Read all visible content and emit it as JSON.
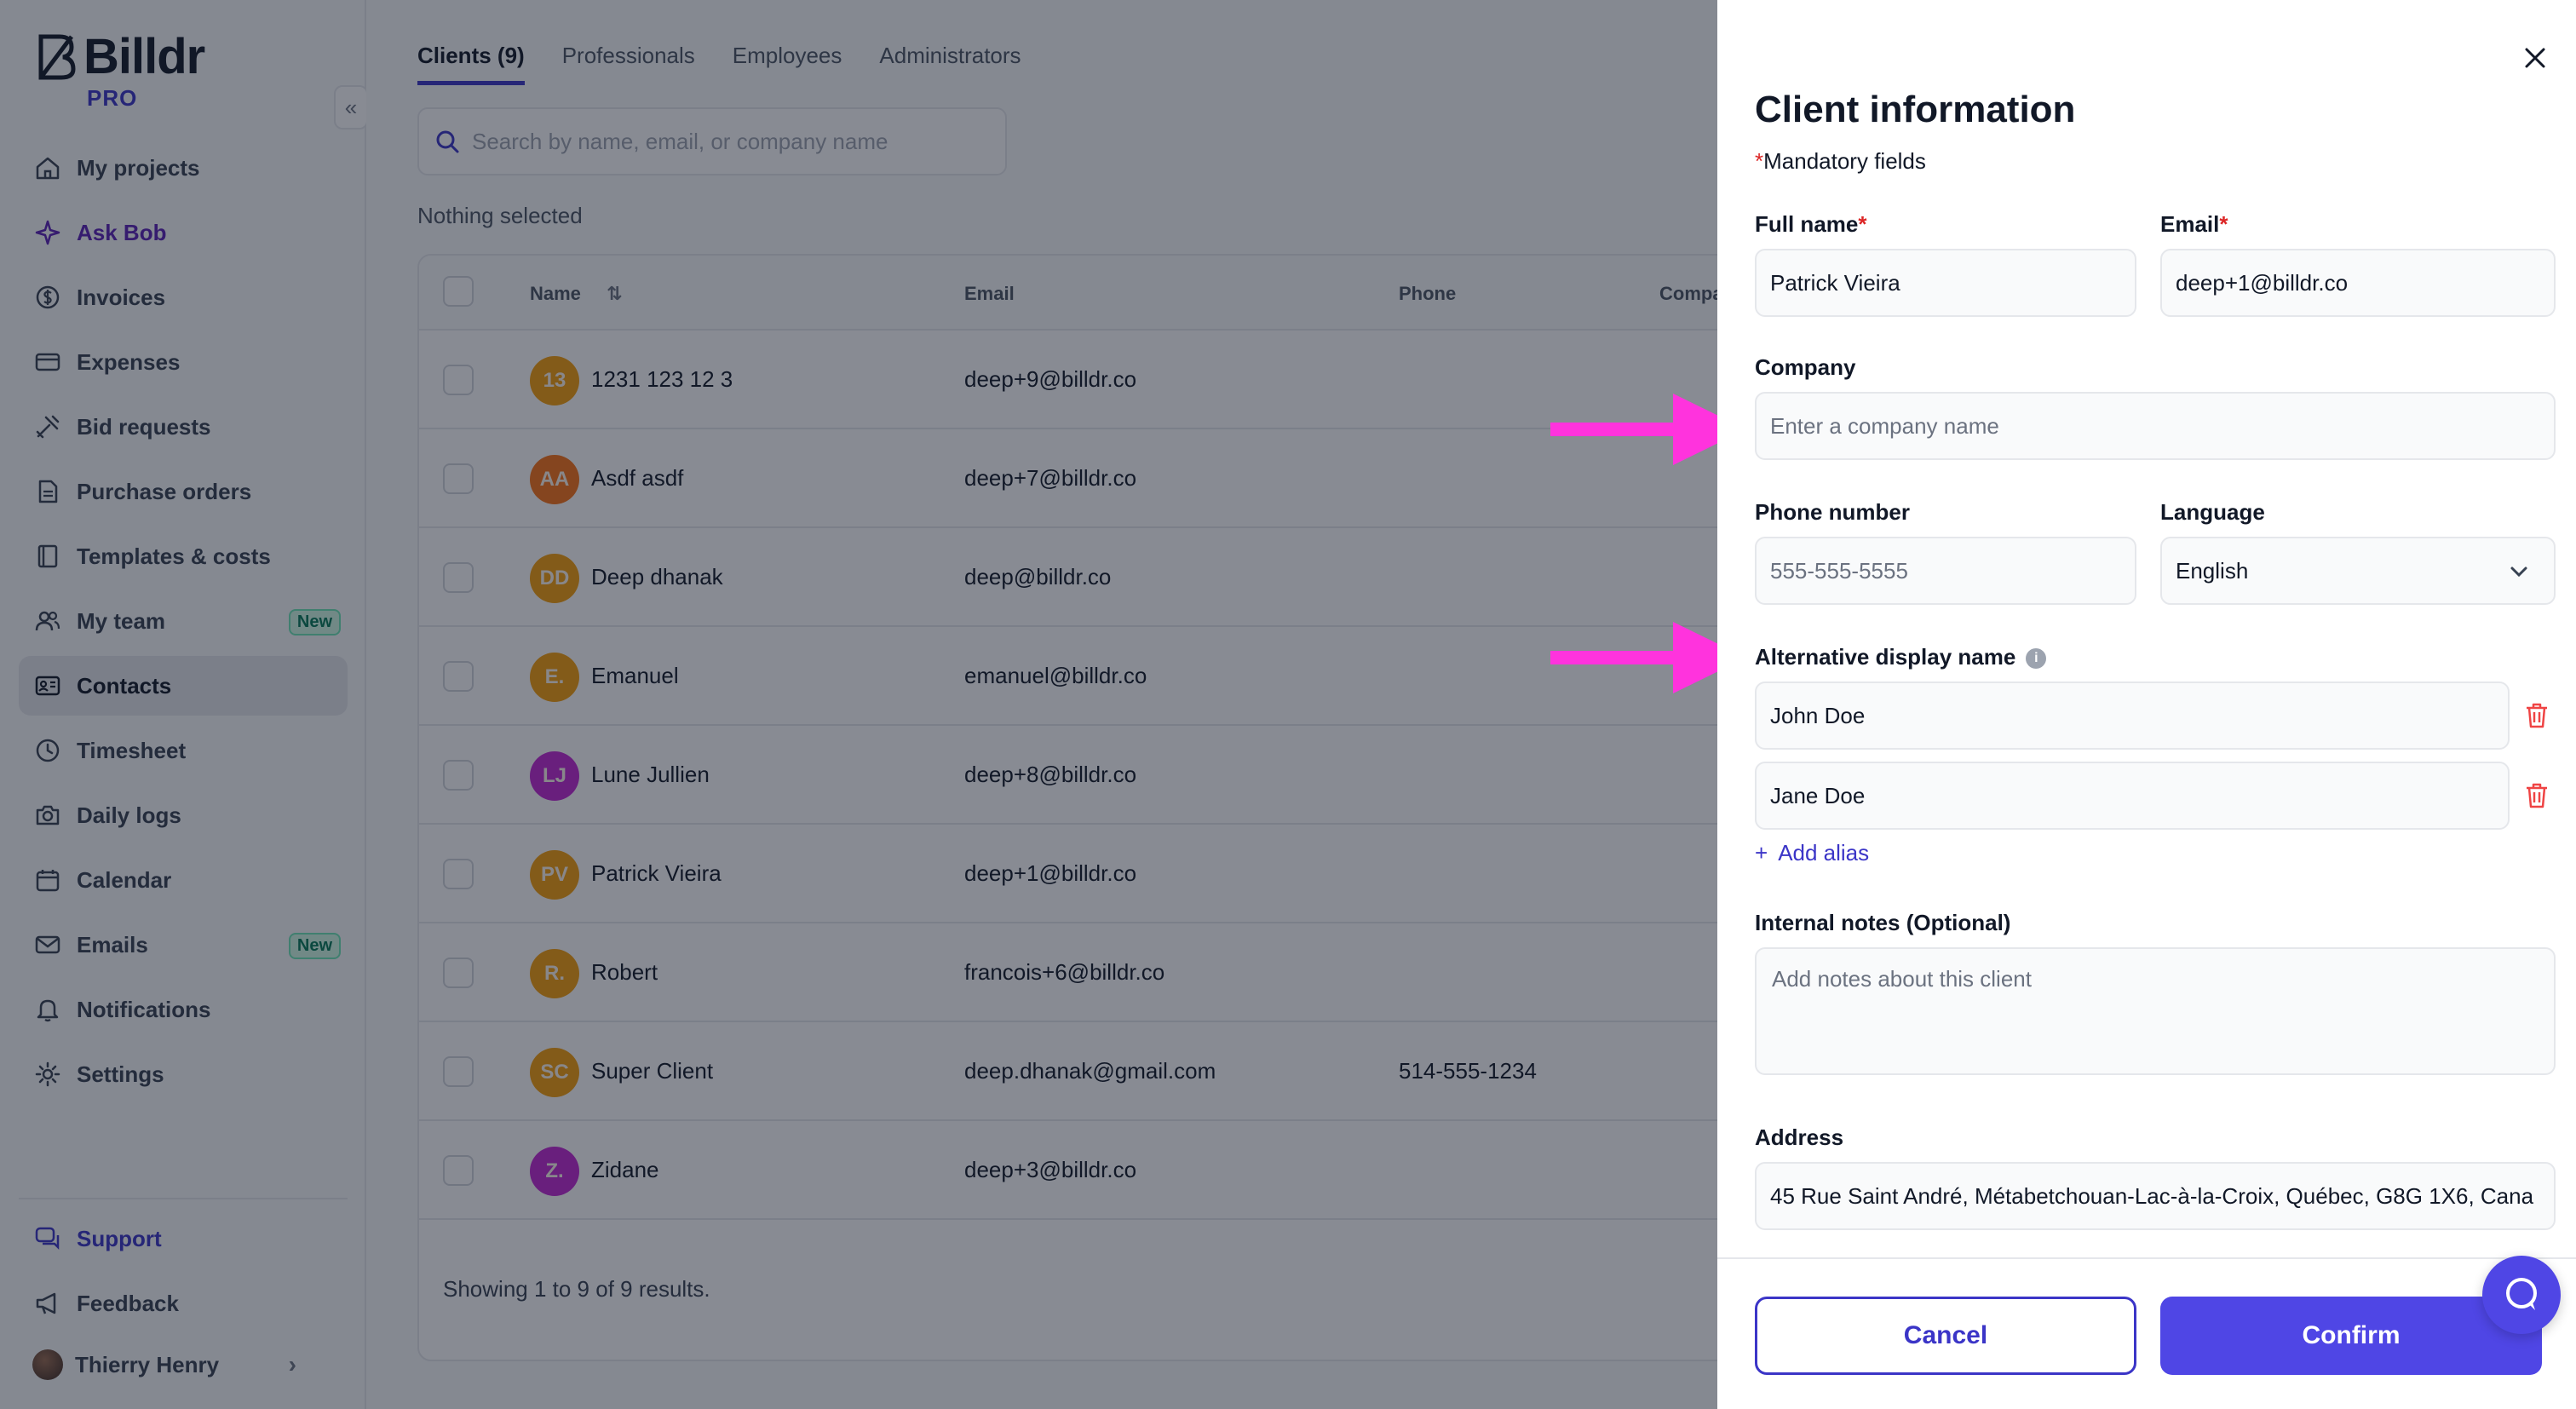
{
  "brand": {
    "name": "Billdr",
    "tier": "PRO"
  },
  "sidebar": {
    "items": [
      {
        "label": "My projects",
        "icon": "home-icon"
      },
      {
        "label": "Ask Bob",
        "icon": "sparkles-icon"
      },
      {
        "label": "Invoices",
        "icon": "dollar-circle-icon"
      },
      {
        "label": "Expenses",
        "icon": "credit-card-icon"
      },
      {
        "label": "Bid requests",
        "icon": "tools-icon"
      },
      {
        "label": "Purchase orders",
        "icon": "document-icon"
      },
      {
        "label": "Templates & costs",
        "icon": "book-icon"
      },
      {
        "label": "My team",
        "icon": "users-icon",
        "badge": "New"
      },
      {
        "label": "Contacts",
        "icon": "contact-card-icon",
        "active": true
      },
      {
        "label": "Timesheet",
        "icon": "clock-icon"
      },
      {
        "label": "Daily logs",
        "icon": "camera-icon"
      },
      {
        "label": "Calendar",
        "icon": "calendar-icon"
      },
      {
        "label": "Emails",
        "icon": "mail-icon",
        "badge": "New"
      },
      {
        "label": "Notifications",
        "icon": "bell-icon"
      },
      {
        "label": "Settings",
        "icon": "gear-icon"
      }
    ],
    "support_label": "Support",
    "feedback_label": "Feedback",
    "user_name": "Thierry Henry"
  },
  "contacts": {
    "tabs": [
      "Clients (9)",
      "Professionals",
      "Employees",
      "Administrators"
    ],
    "search_placeholder": "Search by name, email, or company name",
    "selection_status": "Nothing selected",
    "columns": {
      "name": "Name",
      "email": "Email",
      "phone": "Phone",
      "company": "Compa"
    },
    "rows": [
      {
        "initials": "13",
        "name": "1231 123 12 3",
        "email": "deep+9@billdr.co",
        "phone": "",
        "color": "#f59e0b"
      },
      {
        "initials": "AA",
        "name": "Asdf asdf",
        "email": "deep+7@billdr.co",
        "phone": "",
        "color": "#f97316"
      },
      {
        "initials": "DD",
        "name": "Deep dhanak",
        "email": "deep@billdr.co",
        "phone": "",
        "color": "#f59e0b"
      },
      {
        "initials": "E.",
        "name": "Emanuel",
        "email": "emanuel@billdr.co",
        "phone": "",
        "color": "#f59e0b"
      },
      {
        "initials": "LJ",
        "name": "Lune Jullien",
        "email": "deep+8@billdr.co",
        "phone": "",
        "color": "#c026d3"
      },
      {
        "initials": "PV",
        "name": "Patrick Vieira",
        "email": "deep+1@billdr.co",
        "phone": "",
        "color": "#f59e0b"
      },
      {
        "initials": "R.",
        "name": "Robert",
        "email": "francois+6@billdr.co",
        "phone": "",
        "color": "#f59e0b"
      },
      {
        "initials": "SC",
        "name": "Super Client",
        "email": "deep.dhanak@gmail.com",
        "phone": "514-555-1234",
        "color": "#f59e0b"
      },
      {
        "initials": "Z.",
        "name": "Zidane",
        "email": "deep+3@billdr.co",
        "phone": "",
        "color": "#c026d3"
      }
    ],
    "results_text": "Showing 1 to 9 of 9 results."
  },
  "drawer": {
    "title": "Client information",
    "mandatory_note": "Mandatory fields",
    "required_mark": "*",
    "full_name_label": "Full name",
    "full_name_value": "Patrick Vieira",
    "email_label": "Email",
    "email_value": "deep+1@billdr.co",
    "company_label": "Company",
    "company_placeholder": "Enter a company name",
    "phone_label": "Phone number",
    "phone_placeholder": "555-555-5555",
    "language_label": "Language",
    "language_value": "English",
    "alias_label": "Alternative display name",
    "aliases": [
      "John Doe",
      "Jane Doe"
    ],
    "add_alias_label": "Add alias",
    "notes_label": "Internal notes (Optional)",
    "notes_placeholder": "Add notes about this client",
    "address_label": "Address",
    "address_value": "45 Rue Saint André, Métabetchouan-Lac-à-la-Croix, Québec, G8G 1X6, Cana",
    "cancel_label": "Cancel",
    "confirm_label": "Confirm"
  },
  "colors": {
    "accent": "#4f46e5",
    "brand_purple": "#3b35c7",
    "annotation_arrow": "#ff33dd",
    "required_red": "#dc2626",
    "trash_red": "#ef4444"
  }
}
